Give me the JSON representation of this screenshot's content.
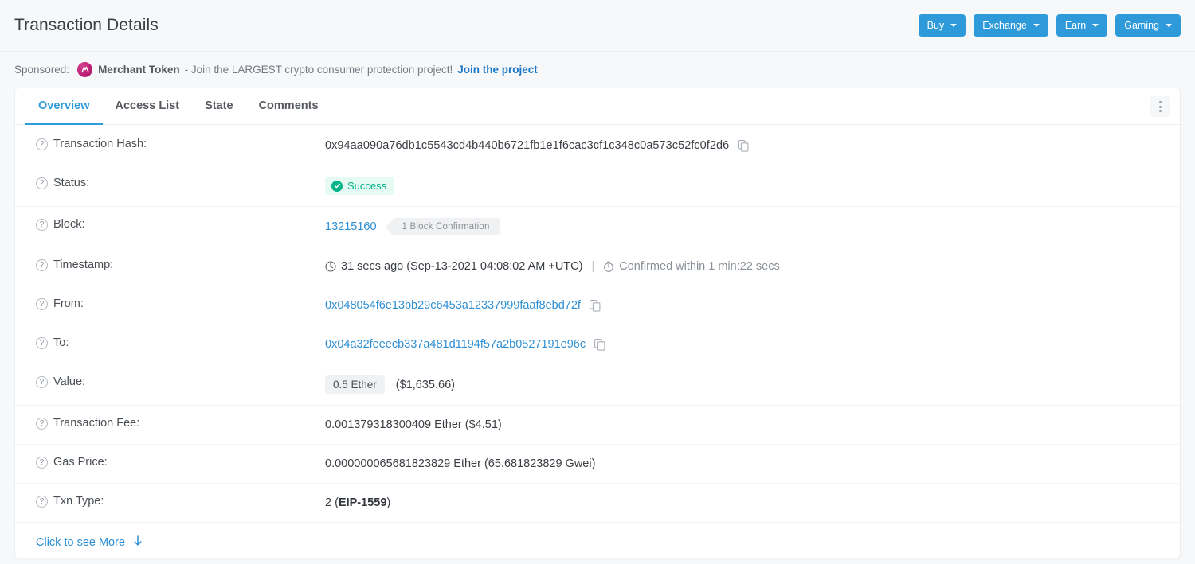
{
  "header": {
    "title": "Transaction Details",
    "buttons": [
      {
        "label": "Buy",
        "icon": "chevron-down-icon"
      },
      {
        "label": "Exchange",
        "icon": "chevron-down-icon"
      },
      {
        "label": "Earn",
        "icon": "chevron-down-icon"
      },
      {
        "label": "Gaming",
        "icon": "chevron-down-icon"
      }
    ],
    "accent_color": "#2f9ada"
  },
  "sponsored": {
    "label": "Sponsored:",
    "brand": "Merchant Token",
    "logo_icon": "merchant-token-logo",
    "text": "- Join the LARGEST crypto consumer protection project!",
    "cta": "Join the project",
    "cta_color": "#1a76c4"
  },
  "card": {
    "tabs": [
      {
        "label": "Overview",
        "active": true
      },
      {
        "label": "Access List",
        "active": false
      },
      {
        "label": "State",
        "active": false
      },
      {
        "label": "Comments",
        "active": false
      }
    ],
    "menu_icon": "kebab-menu-icon"
  },
  "rows": {
    "transaction_hash": {
      "label": "Transaction Hash:",
      "value": "0x94aa090a76db1c5543cd4b440b6721fb1e1f6cac3cf1c348c0a573c52fc0f2d6",
      "copy_icon": "copy-icon"
    },
    "status": {
      "label": "Status:",
      "value": "Success",
      "icon": "check-circle-icon",
      "color": "#00b389",
      "background": "#e6faf4"
    },
    "block": {
      "label": "Block:",
      "number": "13215160",
      "confirmation": "1 Block Confirmation"
    },
    "timestamp": {
      "label": "Timestamp:",
      "ago": "31 secs ago (Sep-13-2021 04:08:02 AM +UTC)",
      "separator": "|",
      "confirmed_within": "Confirmed within 1 min:22 secs",
      "clock_icon": "clock-icon",
      "stopwatch_icon": "stopwatch-icon"
    },
    "from": {
      "label": "From:",
      "address": "0x048054f6e13bb29c6453a12337999faaf8ebd72f",
      "copy_icon": "copy-icon"
    },
    "to": {
      "label": "To:",
      "address": "0x04a32feeecb337a481d1194f57a2b0527191e96c",
      "copy_icon": "copy-icon"
    },
    "value": {
      "label": "Value:",
      "amount": "0.5 Ether",
      "usd": "($1,635.66)"
    },
    "transaction_fee": {
      "label": "Transaction Fee:",
      "value": "0.001379318300409 Ether ($4.51)"
    },
    "gas_price": {
      "label": "Gas Price:",
      "value": "0.000000065681823829 Ether (65.681823829 Gwei)"
    },
    "txn_type": {
      "label": "Txn Type:",
      "prefix": "2 (",
      "standard": "EIP-1559",
      "suffix": ")"
    }
  },
  "footer": {
    "see_more": "Click to see More",
    "arrow_icon": "arrow-down-icon"
  }
}
